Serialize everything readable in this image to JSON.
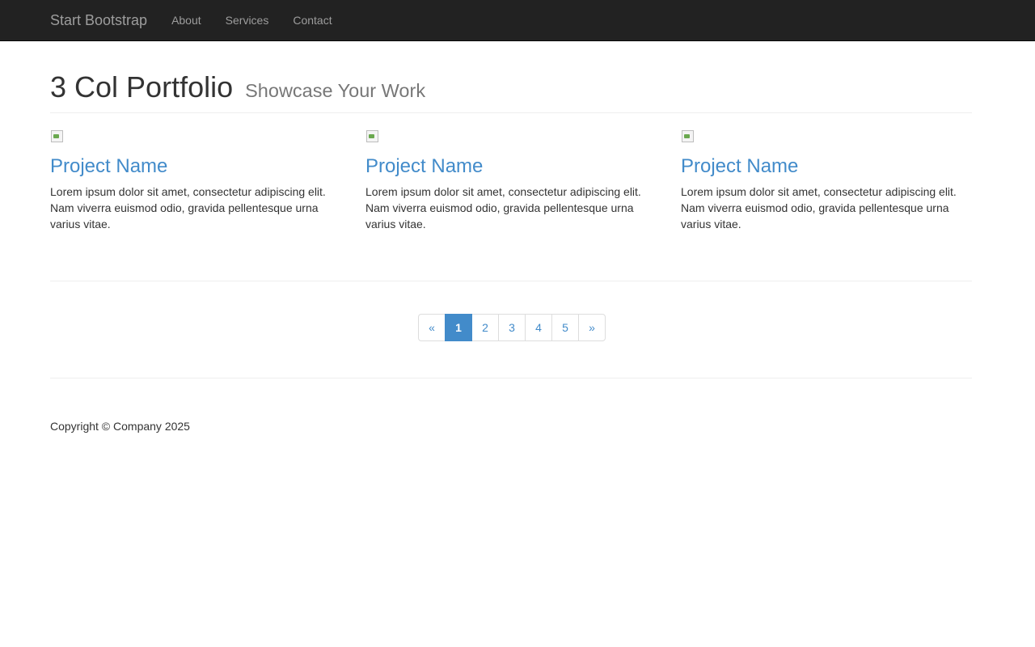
{
  "navbar": {
    "brand": "Start Bootstrap",
    "links": [
      "About",
      "Services",
      "Contact"
    ]
  },
  "header": {
    "title": "3 Col Portfolio",
    "subtitle": "Showcase Your Work"
  },
  "projects": [
    {
      "title": "Project Name",
      "text": "Lorem ipsum dolor sit amet, consectetur adipiscing elit. Nam viverra euismod odio, gravida pellentesque urna varius vitae."
    },
    {
      "title": "Project Name",
      "text": "Lorem ipsum dolor sit amet, consectetur adipiscing elit. Nam viverra euismod odio, gravida pellentesque urna varius vitae."
    },
    {
      "title": "Project Name",
      "text": "Lorem ipsum dolor sit amet, consectetur adipiscing elit. Nam viverra euismod odio, gravida pellentesque urna varius vitae."
    }
  ],
  "pagination": {
    "prev": "«",
    "pages": [
      "1",
      "2",
      "3",
      "4",
      "5"
    ],
    "next": "»",
    "active": "1"
  },
  "footer": {
    "copyright": "Copyright © Company 2025"
  },
  "colors": {
    "navbar_bg": "#222222",
    "link": "#428bca",
    "active_page_bg": "#428bca"
  }
}
